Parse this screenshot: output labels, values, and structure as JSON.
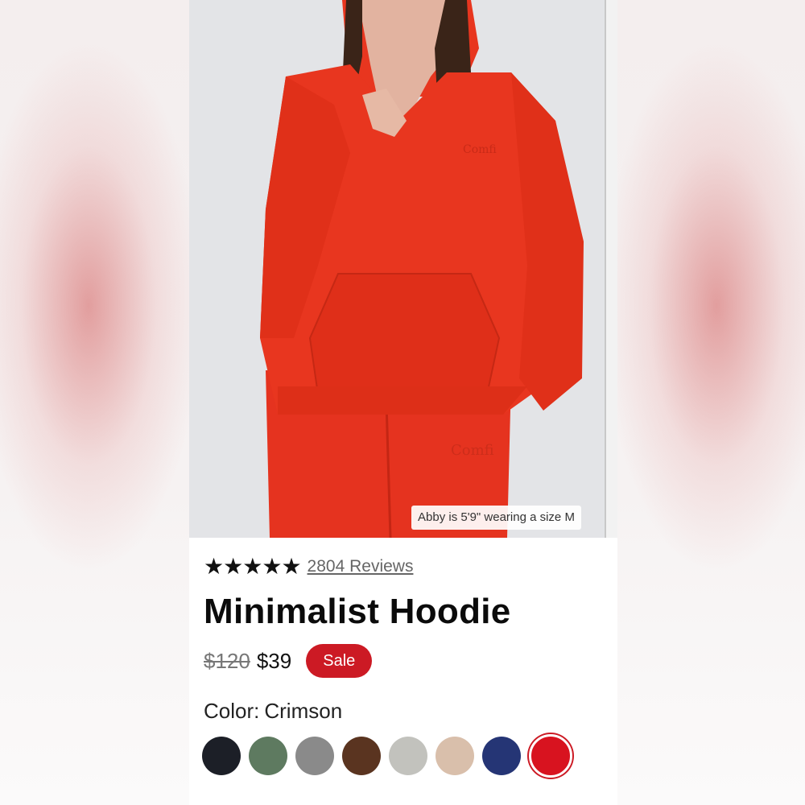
{
  "photo": {
    "caption": "Abby is 5'9\" wearing a size M",
    "embroidery": "Comfi",
    "hoodie_color": "#e8331f"
  },
  "product": {
    "rating_stars": 5,
    "reviews_label": "2804 Reviews",
    "title": "Minimalist Hoodie",
    "original_price": "$120",
    "sale_price": "$39",
    "sale_badge": "Sale",
    "color_label": "Color:",
    "color_value": "Crimson"
  },
  "swatches": [
    {
      "name": "black",
      "hex": "#1c1f27"
    },
    {
      "name": "green",
      "hex": "#5e7a60"
    },
    {
      "name": "gray",
      "hex": "#8a8a8a"
    },
    {
      "name": "brown",
      "hex": "#5a3420"
    },
    {
      "name": "light-gray",
      "hex": "#c2c2bd"
    },
    {
      "name": "beige",
      "hex": "#d9bfab"
    },
    {
      "name": "navy",
      "hex": "#253575"
    },
    {
      "name": "crimson",
      "hex": "#d8131f",
      "selected": true
    }
  ],
  "colors": {
    "accent": "#cc1a24"
  }
}
